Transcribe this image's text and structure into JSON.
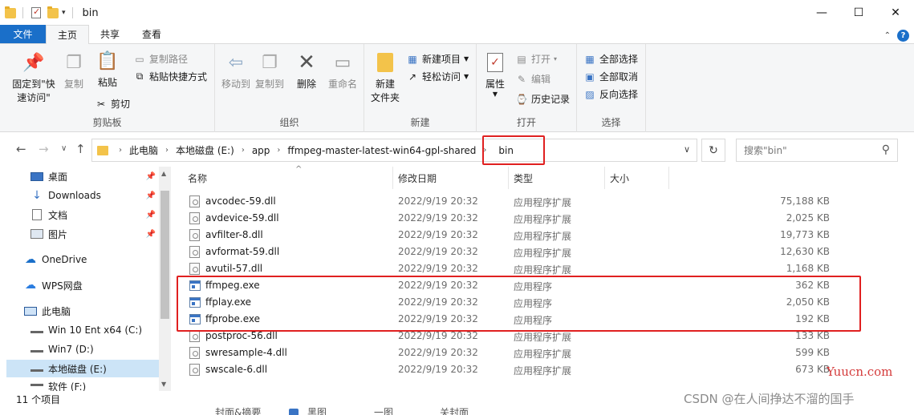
{
  "window": {
    "title": "bin",
    "controls": {
      "minimize": "—",
      "maximize": "☐",
      "close": "✕"
    }
  },
  "ribbon_tabs": [
    "文件",
    "主页",
    "共享",
    "查看"
  ],
  "ribbon": {
    "clipboard": {
      "pin_label": "固定到\"快速访问\"",
      "copy": "复制",
      "paste": "粘贴",
      "copy_path": "复制路径",
      "paste_shortcut": "粘贴快捷方式",
      "cut": "剪切",
      "group": "剪贴板"
    },
    "organize": {
      "move_to": "移动到",
      "copy_to": "复制到",
      "delete": "删除",
      "rename": "重命名",
      "group": "组织"
    },
    "new": {
      "new_folder": "新建\n文件夹",
      "new_item": "新建项目",
      "easy_access": "轻松访问",
      "group": "新建"
    },
    "open": {
      "properties": "属性",
      "open": "打开",
      "edit": "编辑",
      "history": "历史记录",
      "group": "打开"
    },
    "select": {
      "select_all": "全部选择",
      "select_none": "全部取消",
      "invert": "反向选择",
      "group": "选择"
    }
  },
  "address": {
    "crumbs": [
      "此电脑",
      "本地磁盘 (E:)",
      "app",
      "ffmpeg-master-latest-win64-gpl-shared",
      "bin"
    ],
    "search_placeholder": "搜索\"bin\""
  },
  "nav_pane": {
    "items": [
      {
        "label": "桌面",
        "icon": "desktop-icon",
        "pinned": true
      },
      {
        "label": "Downloads",
        "icon": "download-icon",
        "pinned": true
      },
      {
        "label": "文档",
        "icon": "document-icon",
        "pinned": true
      },
      {
        "label": "图片",
        "icon": "picture-icon",
        "pinned": true
      },
      {
        "label": "OneDrive",
        "icon": "cloud-icon"
      },
      {
        "label": "WPS网盘",
        "icon": "cloud-icon"
      },
      {
        "label": "此电脑",
        "icon": "computer-icon"
      },
      {
        "label": "Win 10 Ent x64 (C:)",
        "icon": "drive-icon"
      },
      {
        "label": "Win7 (D:)",
        "icon": "drive-icon"
      },
      {
        "label": "本地磁盘 (E:)",
        "icon": "drive-icon",
        "selected": true
      },
      {
        "label": "软件 (F:)",
        "icon": "drive-icon"
      }
    ]
  },
  "columns": [
    "名称",
    "修改日期",
    "类型",
    "大小"
  ],
  "files": [
    {
      "name": "avcodec-59.dll",
      "date": "2022/9/19 20:32",
      "type": "应用程序扩展",
      "size": "75,188 KB",
      "kind": "dll"
    },
    {
      "name": "avdevice-59.dll",
      "date": "2022/9/19 20:32",
      "type": "应用程序扩展",
      "size": "2,025 KB",
      "kind": "dll"
    },
    {
      "name": "avfilter-8.dll",
      "date": "2022/9/19 20:32",
      "type": "应用程序扩展",
      "size": "19,773 KB",
      "kind": "dll"
    },
    {
      "name": "avformat-59.dll",
      "date": "2022/9/19 20:32",
      "type": "应用程序扩展",
      "size": "12,630 KB",
      "kind": "dll"
    },
    {
      "name": "avutil-57.dll",
      "date": "2022/9/19 20:32",
      "type": "应用程序扩展",
      "size": "1,168 KB",
      "kind": "dll"
    },
    {
      "name": "ffmpeg.exe",
      "date": "2022/9/19 20:32",
      "type": "应用程序",
      "size": "362 KB",
      "kind": "exe"
    },
    {
      "name": "ffplay.exe",
      "date": "2022/9/19 20:32",
      "type": "应用程序",
      "size": "2,050 KB",
      "kind": "exe"
    },
    {
      "name": "ffprobe.exe",
      "date": "2022/9/19 20:32",
      "type": "应用程序",
      "size": "192 KB",
      "kind": "exe"
    },
    {
      "name": "postproc-56.dll",
      "date": "2022/9/19 20:32",
      "type": "应用程序扩展",
      "size": "133 KB",
      "kind": "dll"
    },
    {
      "name": "swresample-4.dll",
      "date": "2022/9/19 20:32",
      "type": "应用程序扩展",
      "size": "599 KB",
      "kind": "dll"
    },
    {
      "name": "swscale-6.dll",
      "date": "2022/9/19 20:32",
      "type": "应用程序扩展",
      "size": "673 KB",
      "kind": "dll"
    }
  ],
  "status": {
    "count": "11 个项目"
  },
  "bottom_strip": [
    "封面&摘要",
    "黑图",
    "一图",
    "关封面"
  ],
  "watermarks": {
    "site": "Yuucn.com",
    "csdn": "CSDN @在人间挣达不溜的国手"
  },
  "colors": {
    "accent": "#1a6fc9",
    "highlight": "#e02020",
    "selected": "#cce4f7"
  }
}
